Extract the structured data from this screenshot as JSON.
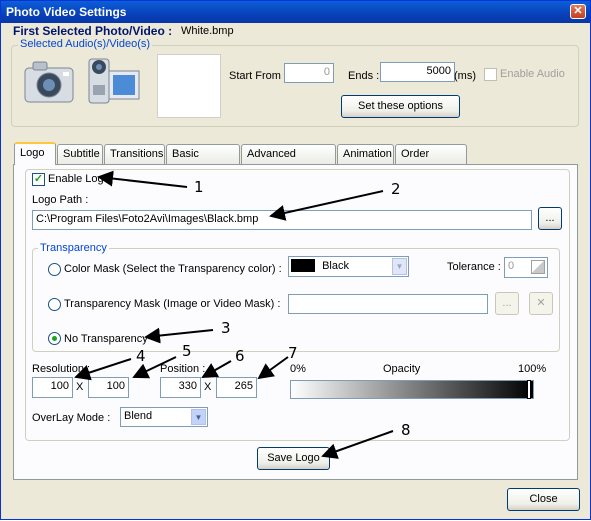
{
  "window": {
    "title": "Photo Video Settings",
    "close_glyph": "✕"
  },
  "header": {
    "first_selected_label": "First Selected Photo/Video :",
    "first_selected_value": "White.bmp"
  },
  "audio_group": {
    "legend": "Selected Audio(s)/Video(s)",
    "start_from_label": "Start From :",
    "start_from_value": "0",
    "ends_label": "Ends :",
    "ends_value": "5000",
    "ends_unit": "(ms)",
    "enable_audio_label": "Enable Audio",
    "set_options_label": "Set these options"
  },
  "tabs": [
    {
      "label": "Logo",
      "active": true
    },
    {
      "label": "Subtitle"
    },
    {
      "label": "Transitions"
    },
    {
      "label": "Basic Effects"
    },
    {
      "label": "Advanced Effects"
    },
    {
      "label": "Animation"
    },
    {
      "label": "Order Effects"
    }
  ],
  "logo": {
    "enable_logo_label": "Enable Logo",
    "enable_logo_checked": true,
    "logo_path_label": "Logo Path :",
    "logo_path_value": "C:\\Program Files\\Foto2Avi\\Images\\Black.bmp",
    "browse_label": "...",
    "transparency": {
      "legend": "Transparency",
      "color_mask_label": "Color Mask (Select the Transparency color) :",
      "color_value": "Black",
      "color_swatch": "#000000",
      "tolerance_label": "Tolerance :",
      "tolerance_value": "0",
      "transparency_mask_label": "Transparency Mask (Image or Video Mask) :",
      "mask_browse_label": "...",
      "mask_clear_label": "✕",
      "no_transparency_label": "No Transparency",
      "selected": "none"
    },
    "resolution_label": "Resolution :",
    "res_w": "100",
    "res_h": "100",
    "position_label": "Position :",
    "pos_x": "330",
    "pos_y": "265",
    "times": "X",
    "opacity_min": "0%",
    "opacity_label": "Opacity",
    "opacity_max": "100%",
    "opacity_level": 1.0,
    "overlay_label": "OverLay Mode :",
    "overlay_value": "Blend",
    "save_logo_label": "Save Logo"
  },
  "footer": {
    "close_label": "Close"
  },
  "annotations": [
    "1",
    "2",
    "3",
    "4",
    "5",
    "6",
    "7",
    "8"
  ]
}
